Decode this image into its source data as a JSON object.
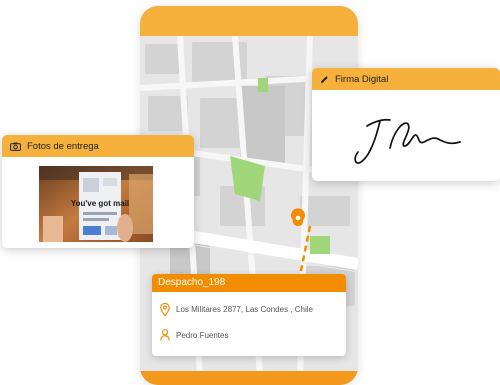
{
  "photo_card": {
    "title": "Fotos de entrega",
    "photo_text": "You've got mail"
  },
  "signature_card": {
    "title": "Firma Digital"
  },
  "dispatch_card": {
    "title": "Despacho_198",
    "address": "Los Militares 2877, Las Condes , Chile",
    "customer": "Pedro Fuentes"
  },
  "icons": {
    "photo": "camera-icon",
    "signature": "pencil-icon",
    "address": "location-pin-icon",
    "customer": "person-icon",
    "map_marker": "map-pin-icon"
  },
  "colors": {
    "orange_dark": "#f28c00",
    "orange_light": "#f5b13c",
    "map_bg": "#e6e6e6",
    "map_block": "#d2d2d2",
    "map_green": "#9fd67a"
  }
}
